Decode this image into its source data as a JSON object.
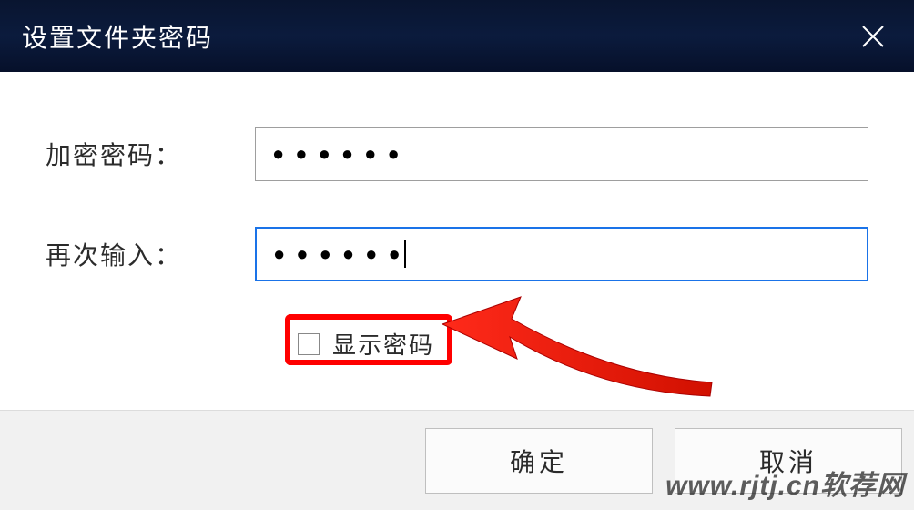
{
  "title": "设置文件夹密码",
  "form": {
    "password_label": "加密密码：",
    "confirm_label": "再次输入：",
    "password_masked": "●●●●●●",
    "confirm_masked": "●●●●●●",
    "show_password_label": "显示密码",
    "show_password_checked": false
  },
  "buttons": {
    "ok": "确定",
    "cancel": "取消"
  },
  "watermark": "www.rjtj.cn软荐网",
  "colors": {
    "highlight": "#ff0000",
    "focus_border": "#1a73e8"
  }
}
